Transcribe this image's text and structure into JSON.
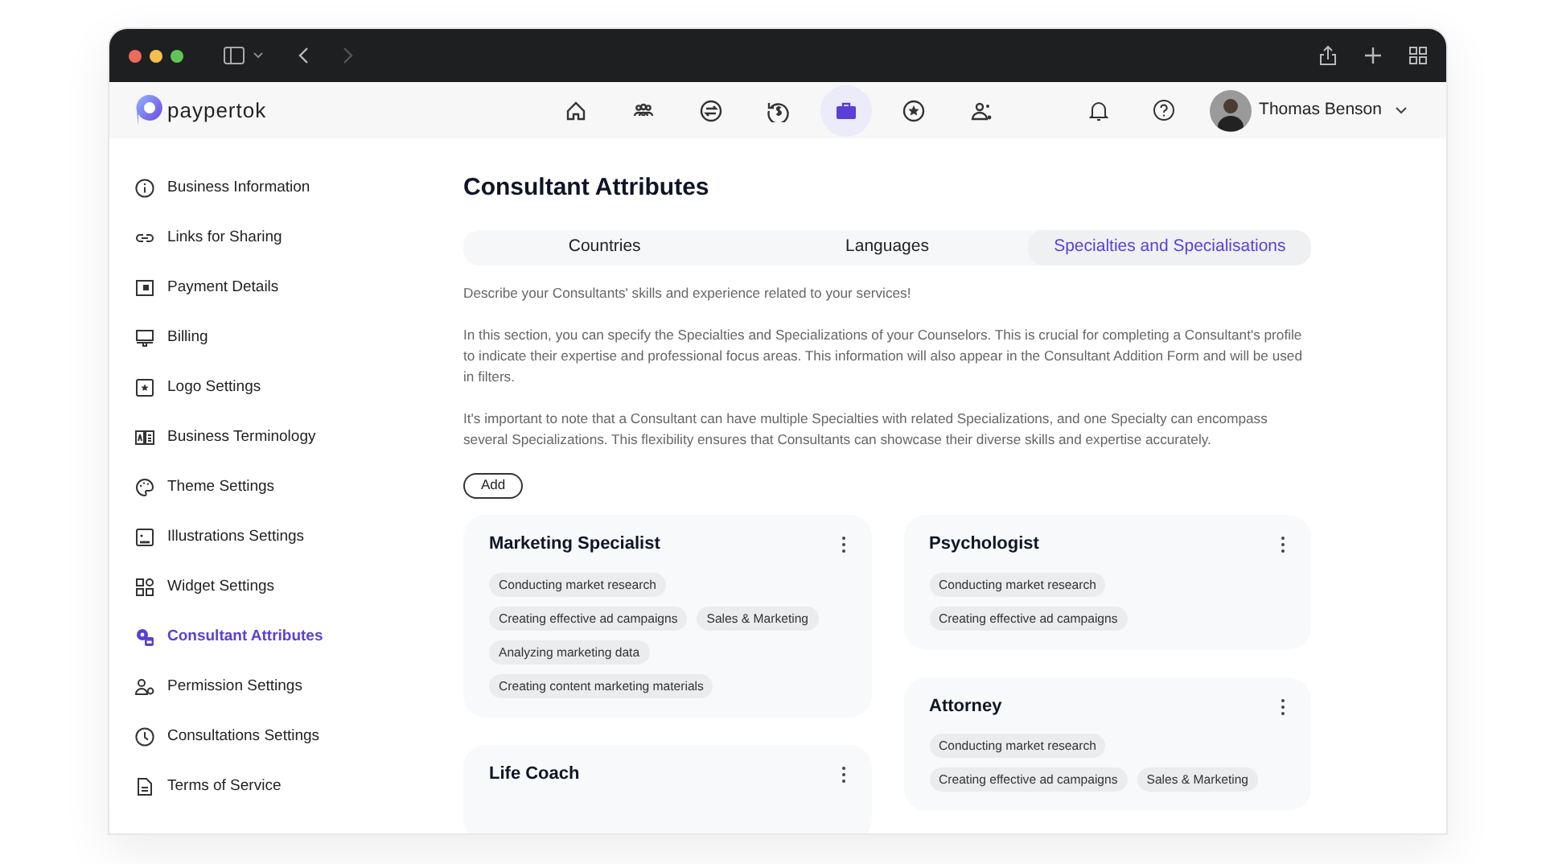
{
  "app": {
    "logo": "paypertok"
  },
  "nav": [
    {
      "kind": "home",
      "selected": false
    },
    {
      "kind": "people",
      "selected": false
    },
    {
      "kind": "exchange",
      "selected": false
    },
    {
      "kind": "history",
      "selected": false
    },
    {
      "kind": "briefcase",
      "selected": true
    },
    {
      "kind": "star",
      "selected": false
    },
    {
      "kind": "users",
      "selected": false
    }
  ],
  "user": {
    "name": "Thomas Benson"
  },
  "sidebar": {
    "items": [
      {
        "kind": "info",
        "label": "Business Information",
        "selected": false
      },
      {
        "kind": "link",
        "label": "Links for Sharing",
        "selected": false
      },
      {
        "kind": "card",
        "label": "Payment Details",
        "selected": false
      },
      {
        "kind": "billing",
        "label": "Billing",
        "selected": false
      },
      {
        "kind": "logo",
        "label": "Logo Settings",
        "selected": false
      },
      {
        "kind": "terms",
        "label": "Business Terminology",
        "selected": false
      },
      {
        "kind": "palette",
        "label": "Theme Settings",
        "selected": false
      },
      {
        "kind": "image",
        "label": "Illustrations Settings",
        "selected": false
      },
      {
        "kind": "widget",
        "label": "Widget Settings",
        "selected": false
      },
      {
        "kind": "gear",
        "label": "Consultant Attributes",
        "selected": true
      },
      {
        "kind": "permission",
        "label": "Permission Settings",
        "selected": false
      },
      {
        "kind": "clock",
        "label": "Consultations Settings",
        "selected": false
      },
      {
        "kind": "doc",
        "label": "Terms of Service",
        "selected": false
      }
    ]
  },
  "page": {
    "title": "Consultant Attributes",
    "tabs": [
      {
        "label": "Countries",
        "selected": false
      },
      {
        "label": "Languages",
        "selected": false
      },
      {
        "label": "Specialties and Specialisations",
        "selected": true
      }
    ],
    "paragraphs": [
      "Describe your Consultants' skills and experience related to your services!",
      "In this section, you can specify the Specialties and Specializations of your Counselors. This is crucial for completing a Consultant's profile to indicate their expertise and professional focus areas. This information will also appear in the Consultant Addition Form and will be used in filters.",
      "It's important to note that a Consultant can have multiple Specialties with related Specializations, and one Specialty can encompass several Specializations. This flexibility ensures that Consultants can showcase their diverse skills and expertise accurately."
    ],
    "add_button": "Add",
    "columns": [
      [
        {
          "title": "Marketing Specialist",
          "tags": [
            "Conducting market research",
            "Creating effective ad campaigns",
            "Sales & Marketing",
            "Analyzing marketing data",
            "Creating content marketing materials"
          ]
        },
        {
          "title": "Life Coach"
        }
      ],
      [
        {
          "title": "Psychologist",
          "tags": [
            "Conducting market research",
            "Creating effective ad campaigns"
          ]
        },
        {
          "title": "Attorney",
          "tags": [
            "Conducting market research",
            "Creating effective ad campaigns",
            "Sales & Marketing"
          ]
        }
      ]
    ]
  }
}
